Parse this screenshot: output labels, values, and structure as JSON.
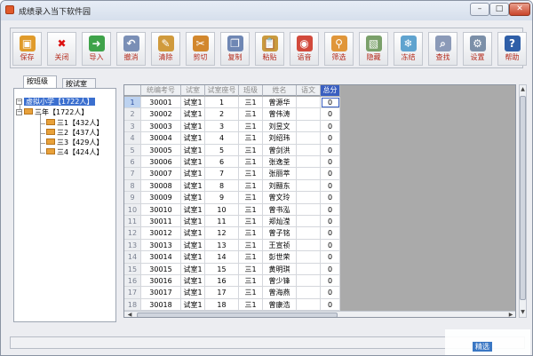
{
  "window": {
    "title": "成绩录入当下软件园",
    "min": "–",
    "max": "□",
    "close": "✕"
  },
  "toolbar": [
    {
      "label": "保存",
      "icon": "save-icon",
      "color": "#e09b2b",
      "glyph": "▣"
    },
    {
      "label": "关闭",
      "icon": "close-icon",
      "color": "#ffffff",
      "glyph": "✖"
    },
    {
      "label": "导入",
      "icon": "import-icon",
      "color": "#3fa34a",
      "glyph": "➜"
    },
    {
      "label": "撤消",
      "icon": "undo-icon",
      "color": "#7a8fb6",
      "glyph": "↶"
    },
    {
      "label": "清除",
      "icon": "clear-icon",
      "color": "#d09a3c",
      "glyph": "✎"
    },
    {
      "label": "剪切",
      "icon": "cut-icon",
      "color": "#d2872d",
      "glyph": "✂"
    },
    {
      "label": "复制",
      "icon": "copy-icon",
      "color": "#6f87b4",
      "glyph": "❐"
    },
    {
      "label": "粘贴",
      "icon": "paste-icon",
      "color": "#c99a3e",
      "glyph": "📋"
    },
    {
      "label": "语音",
      "icon": "voice-icon",
      "color": "#d24a3c",
      "glyph": "◉"
    },
    {
      "label": "筛选",
      "icon": "filter-icon",
      "color": "#e0963a",
      "glyph": "⚲"
    },
    {
      "label": "隐藏",
      "icon": "hide-icon",
      "color": "#7aa06a",
      "glyph": "▧"
    },
    {
      "label": "冻结",
      "icon": "freeze-icon",
      "color": "#5fa3cf",
      "glyph": "❄"
    },
    {
      "label": "查找",
      "icon": "find-icon",
      "color": "#8b9ab8",
      "glyph": "⌕"
    },
    {
      "label": "设置",
      "icon": "settings-icon",
      "color": "#7b8fa8",
      "glyph": "⚙"
    },
    {
      "label": "帮助",
      "icon": "help-icon",
      "color": "#2f5fa8",
      "glyph": "?"
    }
  ],
  "tabs": {
    "by_class": "按班级",
    "by_room": "按试室"
  },
  "tree": {
    "root": "虚拟小学【1722人】",
    "grade": "三年【1722人】",
    "classes": [
      "三1【432人】",
      "三2【437人】",
      "三3【429人】",
      "三4【424人】"
    ]
  },
  "table": {
    "headers": [
      "统编考号",
      "试室",
      "试室座号",
      "班级",
      "姓名",
      "语文",
      "总分"
    ],
    "rows": [
      [
        "1",
        "30001",
        "试室1",
        "1",
        "三1",
        "曾源华",
        "",
        "0"
      ],
      [
        "2",
        "30002",
        "试室1",
        "2",
        "三1",
        "曾伟涛",
        "",
        "0"
      ],
      [
        "3",
        "30003",
        "试室1",
        "3",
        "三1",
        "刘昱文",
        "",
        "0"
      ],
      [
        "4",
        "30004",
        "试室1",
        "4",
        "三1",
        "刘绍玮",
        "",
        "0"
      ],
      [
        "5",
        "30005",
        "试室1",
        "5",
        "三1",
        "曾剑洪",
        "",
        "0"
      ],
      [
        "6",
        "30006",
        "试室1",
        "6",
        "三1",
        "张逸荃",
        "",
        "0"
      ],
      [
        "7",
        "30007",
        "试室1",
        "7",
        "三1",
        "张丽萃",
        "",
        "0"
      ],
      [
        "8",
        "30008",
        "试室1",
        "8",
        "三1",
        "刘翮东",
        "",
        "0"
      ],
      [
        "9",
        "30009",
        "试室1",
        "9",
        "三1",
        "曾文玲",
        "",
        "0"
      ],
      [
        "10",
        "30010",
        "试室1",
        "10",
        "三1",
        "曾书泓",
        "",
        "0"
      ],
      [
        "11",
        "30011",
        "试室1",
        "11",
        "三1",
        "郑灿滢",
        "",
        "0"
      ],
      [
        "12",
        "30012",
        "试室1",
        "12",
        "三1",
        "曾子铭",
        "",
        "0"
      ],
      [
        "13",
        "30013",
        "试室1",
        "13",
        "三1",
        "王宣祯",
        "",
        "0"
      ],
      [
        "14",
        "30014",
        "试室1",
        "14",
        "三1",
        "彭世荣",
        "",
        "0"
      ],
      [
        "15",
        "30015",
        "试室1",
        "15",
        "三1",
        "黄明琪",
        "",
        "0"
      ],
      [
        "16",
        "30016",
        "试室1",
        "16",
        "三1",
        "曾少锋",
        "",
        "0"
      ],
      [
        "17",
        "30017",
        "试室1",
        "17",
        "三1",
        "曾海燕",
        "",
        "0"
      ],
      [
        "18",
        "30018",
        "试室1",
        "18",
        "三1",
        "曾康浩",
        "",
        "0"
      ]
    ]
  },
  "watermark": "精选"
}
